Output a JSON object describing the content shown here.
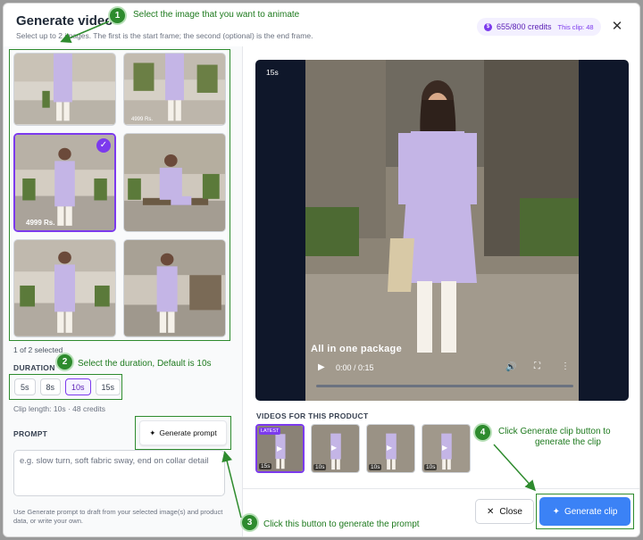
{
  "header": {
    "title": "Generate video",
    "subtitle": "Select up to 2 images. The first is the start frame; the second (optional) is the end frame.",
    "credits": "655/800 credits",
    "clip_cost": "This clip: 48",
    "coin_symbol": "$"
  },
  "images": {
    "selected_price": "4999 Rs.",
    "second_price": "4999 Rs.",
    "selection_count": "1 of 2 selected"
  },
  "duration": {
    "label": "DURATION",
    "options": [
      "5s",
      "8s",
      "10s",
      "15s"
    ],
    "selected": "10s",
    "clip_length": "Clip length: 10s · 48 credits"
  },
  "prompt": {
    "label": "PROMPT",
    "generate_label": "Generate prompt",
    "placeholder": "e.g. slow turn, soft fabric sway, end on collar detail",
    "help": "Use Generate prompt to draft from your selected image(s) and product data, or write your own."
  },
  "video": {
    "duration_badge": "15s",
    "overlay_text": "All in one package",
    "time": "0:00 / 0:15"
  },
  "product_videos": {
    "label": "VIDEOS FOR THIS PRODUCT",
    "latest_tag": "LATEST",
    "items": [
      "15s",
      "10s",
      "10s",
      "10s"
    ]
  },
  "footer": {
    "close_label": "Close",
    "generate_clip_label": "Generate clip"
  },
  "annotations": {
    "step1": "Select the image that you want to animate",
    "step2": "Select the duration, Default is 10s",
    "step3": "Click this button to generate the prompt",
    "step4_line1": "Click Generate clip button to",
    "step4_line2": "generate the clip",
    "n1": "1",
    "n2": "2",
    "n3": "3",
    "n4": "4"
  },
  "colors": {
    "accent": "#7c3aed",
    "primary_button": "#3b82f6",
    "annotation": "#2e8b2e",
    "dress": "#c4b5e6"
  }
}
